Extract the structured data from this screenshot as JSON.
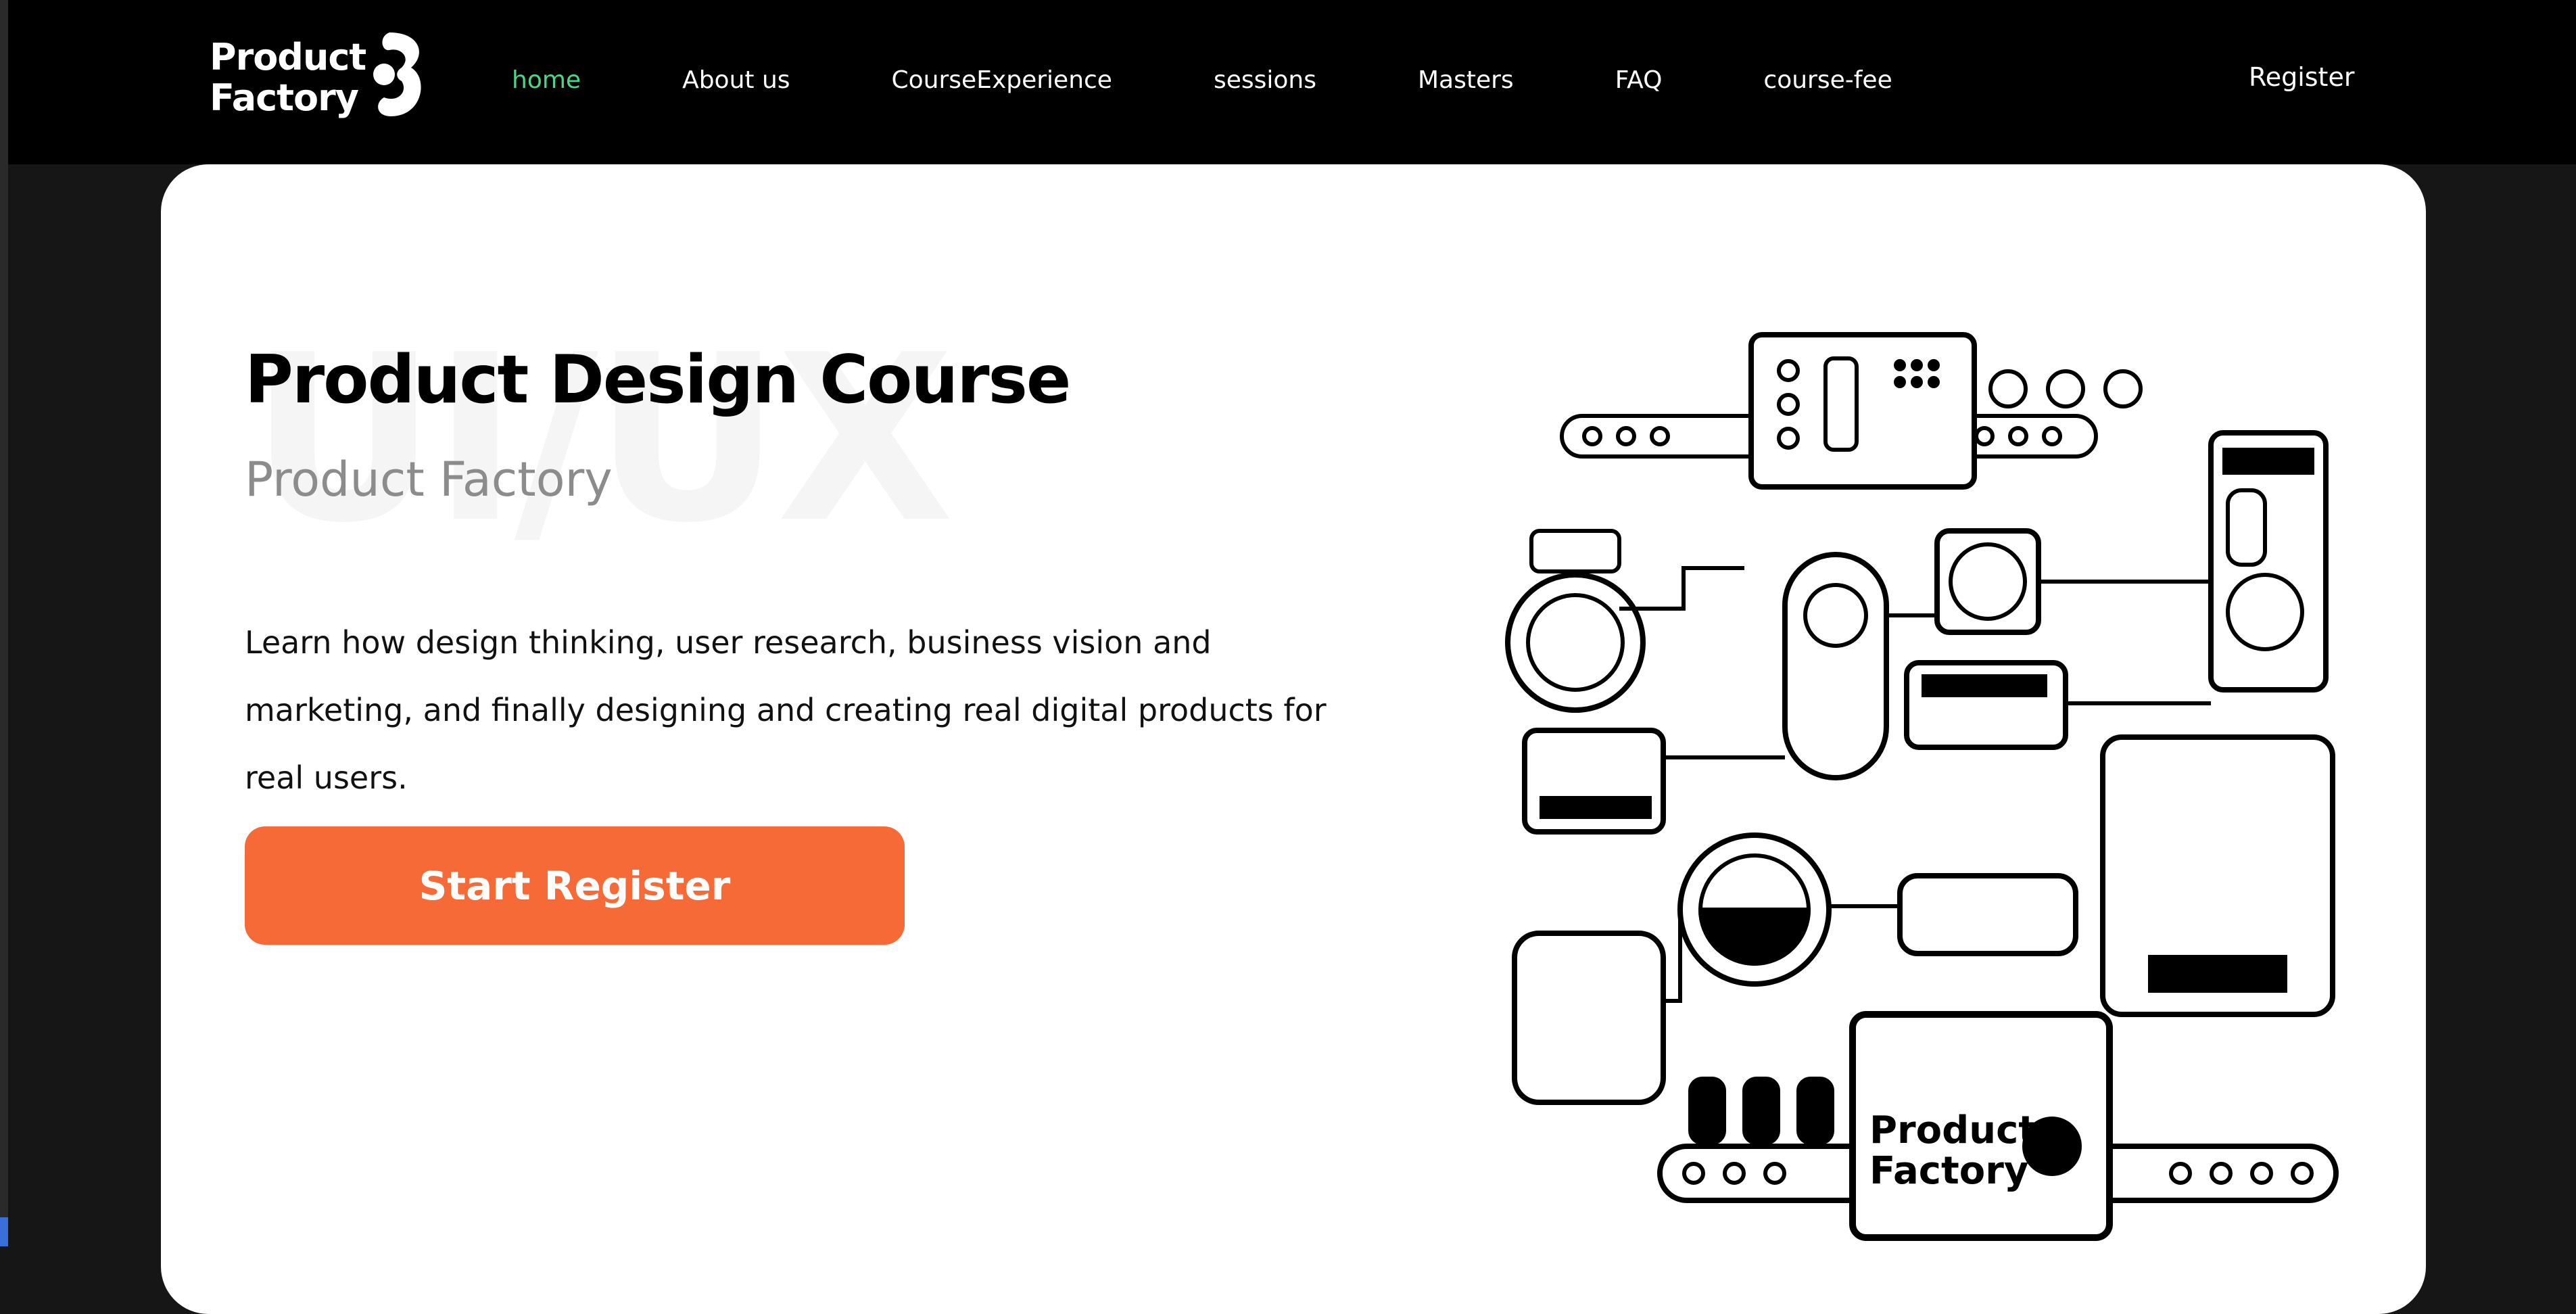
{
  "brand": {
    "line1": "Product",
    "line2": "Factory",
    "logo_icon": "product-factory-logo"
  },
  "nav": {
    "items": [
      {
        "label": "home",
        "active": true
      },
      {
        "label": "About us",
        "active": false
      },
      {
        "label": "CourseExperience",
        "active": false
      },
      {
        "label": "sessions",
        "active": false
      },
      {
        "label": "Masters",
        "active": false
      },
      {
        "label": "FAQ",
        "active": false
      },
      {
        "label": "course-fee",
        "active": false
      }
    ],
    "register_label": "Register"
  },
  "hero": {
    "watermark": "UI/UX",
    "title": "Product Design Course",
    "subtitle": "Product Factory",
    "description": "Learn how design thinking, user research, business vision and marketing, and finally designing and creating real digital products for real users.",
    "cta_label": "Start Register"
  },
  "illustration": {
    "logo_line1": "Product",
    "logo_line2": "Factory",
    "icon": "factory-machine-illustration"
  },
  "colors": {
    "nav_bg": "#000000",
    "active_link": "#4cd68a",
    "cta": "#f56a37",
    "card": "#ffffff",
    "page_bg": "#161616"
  }
}
